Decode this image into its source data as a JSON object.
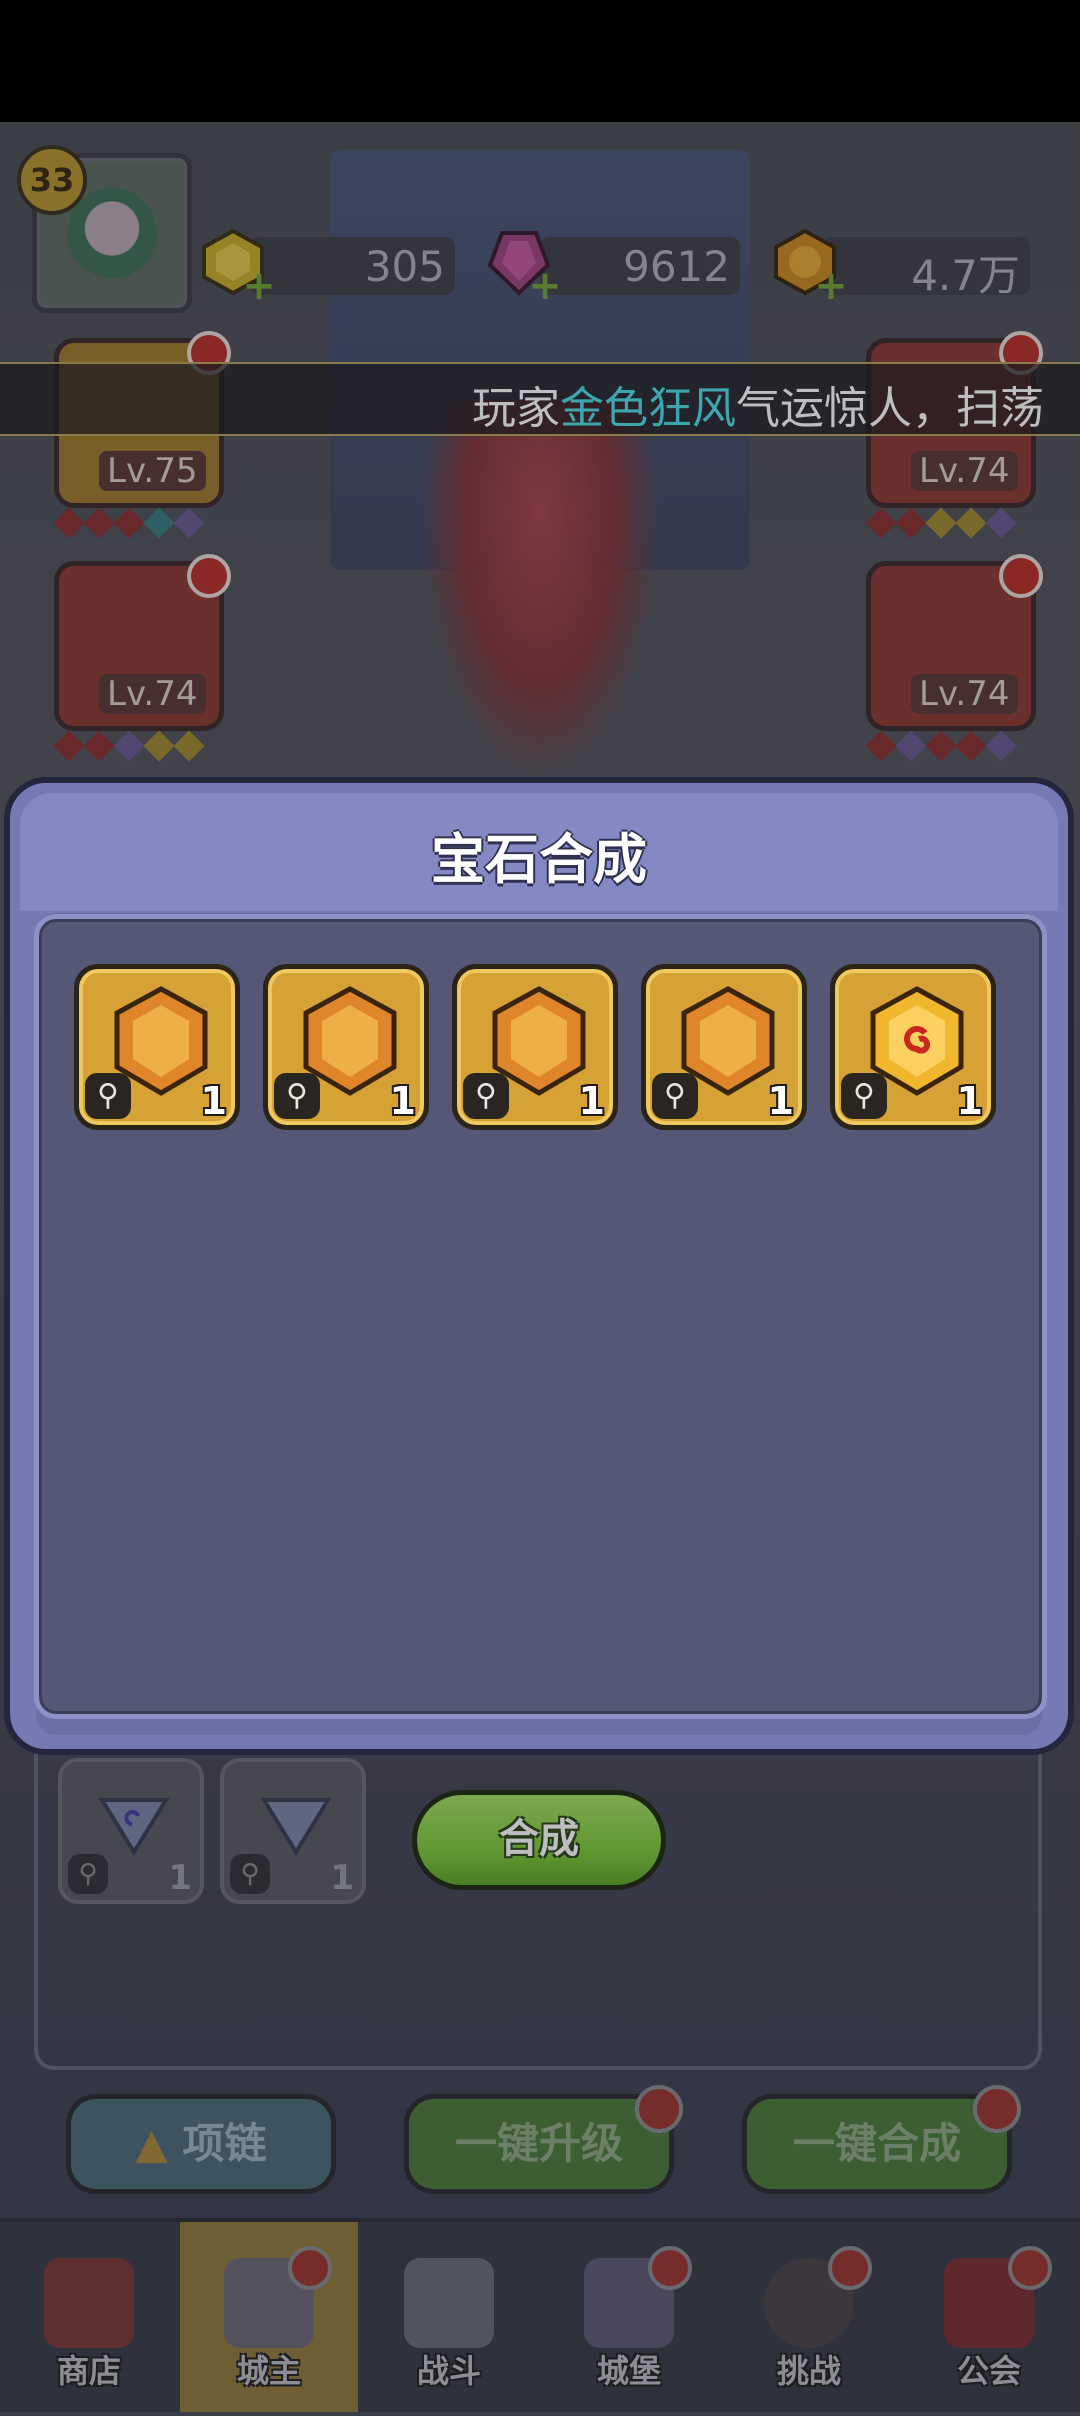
{
  "player": {
    "level": "33"
  },
  "resources": [
    {
      "icon": "gold-coin-icon",
      "value": "305"
    },
    {
      "icon": "pink-gem-icon",
      "value": "9612"
    },
    {
      "icon": "orange-gem-icon",
      "value": "4.7万"
    }
  ],
  "equipment": {
    "crown_level": "Lv.75",
    "armor_level": "Lv.74",
    "right_top_level": "Lv.74",
    "ring_level": "Lv.74"
  },
  "ticker": {
    "prefix": "玩家",
    "name": "金色狂风",
    "suffix": "气运惊人，扫荡"
  },
  "modal": {
    "title": "宝石合成",
    "slots": [
      {
        "icon": "orange-gem-icon",
        "qty": "1"
      },
      {
        "icon": "orange-gem-icon",
        "qty": "1"
      },
      {
        "icon": "orange-gem-icon",
        "qty": "1"
      },
      {
        "icon": "orange-gem-icon",
        "qty": "1"
      },
      {
        "icon": "swirl-gem-icon",
        "qty": "1"
      }
    ]
  },
  "background": {
    "small_slots": [
      {
        "qty": "1"
      },
      {
        "qty": "1"
      }
    ],
    "synth_button": "合成",
    "necklace_button": "项链",
    "upgrade_button": "一键升级",
    "combine_button": "一键合成"
  },
  "nav": [
    {
      "label": "商店",
      "icon": "shop-icon"
    },
    {
      "label": "城主",
      "icon": "lord-icon"
    },
    {
      "label": "战斗",
      "icon": "swords-icon"
    },
    {
      "label": "城堡",
      "icon": "castle-icon"
    },
    {
      "label": "挑战",
      "icon": "challenge-icon"
    },
    {
      "label": "公会",
      "icon": "guild-icon"
    }
  ],
  "colors": {
    "accent_cyan": "#4ee0e6",
    "modal_purple": "#767ab4",
    "gem_orange": "#e8a030",
    "synth_green": "#7fcc3a"
  }
}
